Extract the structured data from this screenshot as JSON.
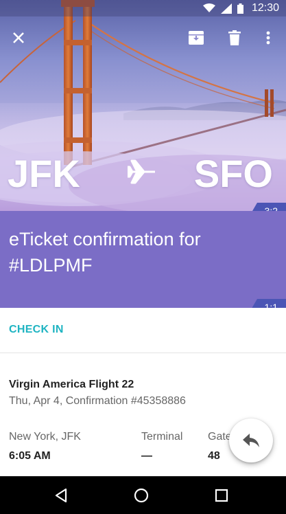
{
  "status_bar": {
    "time": "12:30"
  },
  "toolbar": {
    "close_icon": "close-icon",
    "archive_icon": "archive-icon",
    "delete_icon": "delete-icon",
    "more_icon": "more-vert-icon"
  },
  "hero": {
    "origin": "JFK",
    "destination": "SFO",
    "ratio_tag": "3:2"
  },
  "title_band": {
    "title": "eTicket confirmation for #LDLPMF",
    "ratio_tag": "1:1"
  },
  "content": {
    "check_in_label": "CHECK IN",
    "flight_title": "Virgin America Flight 22",
    "flight_subtitle": "Thu, Apr 4, Confirmation #45358886",
    "columns": [
      {
        "label": "New York, JFK",
        "value": "6:05 AM"
      },
      {
        "label": "Terminal",
        "value": "—"
      },
      {
        "label": "Gate",
        "value": "48"
      }
    ]
  },
  "colors": {
    "title_band": "#7b6dc6",
    "ratio_tag": "#4b55b5",
    "accent_teal": "#1fb4c2"
  },
  "fab": {
    "icon": "reply-icon"
  },
  "nav_bar": {
    "icons": [
      "back-icon",
      "home-icon",
      "recents-icon"
    ]
  }
}
